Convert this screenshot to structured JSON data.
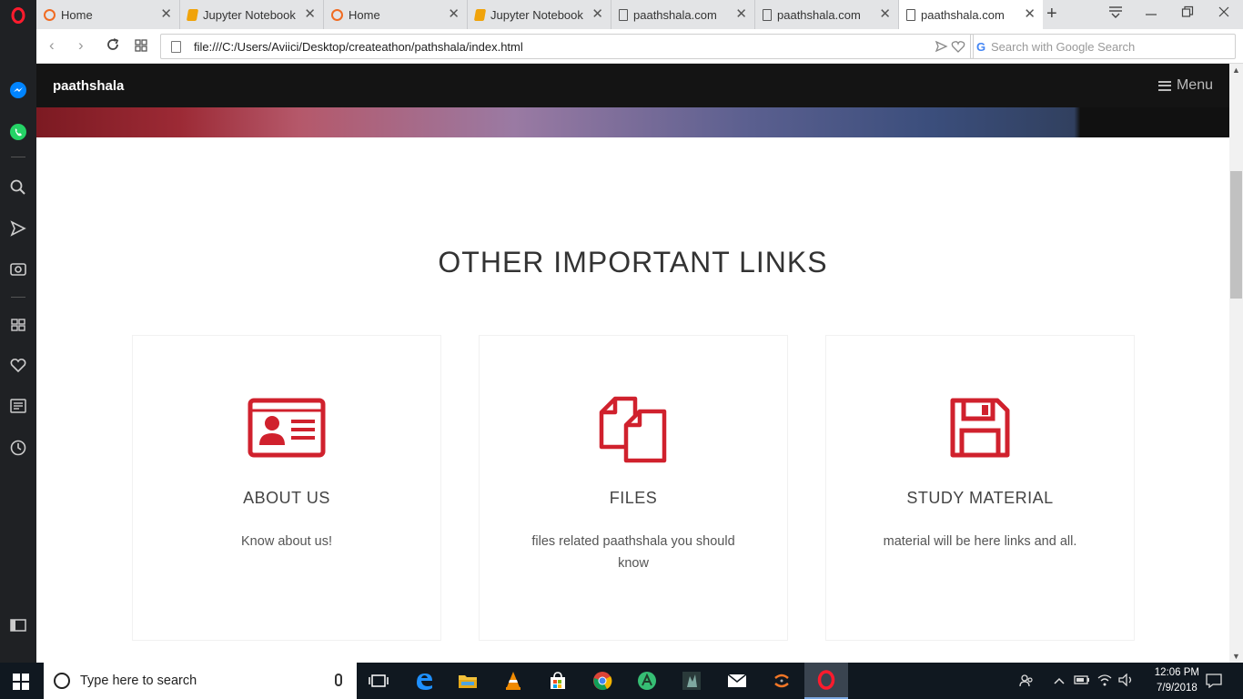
{
  "tabs": [
    {
      "title": "Home",
      "icon": "opera-icon"
    },
    {
      "title": "Jupyter Notebook",
      "icon": "notebook-icon"
    },
    {
      "title": "Home",
      "icon": "opera-icon"
    },
    {
      "title": "Jupyter Notebook",
      "icon": "notebook-icon"
    },
    {
      "title": "paathshala.com",
      "icon": "page-icon"
    },
    {
      "title": "paathshala.com",
      "icon": "page-icon"
    },
    {
      "title": "paathshala.com",
      "icon": "page-icon",
      "active": true
    }
  ],
  "address": {
    "url": "file:///C:/Users/Aviici/Desktop/createathon/pathshala/index.html",
    "search_placeholder": "Search with Google Search"
  },
  "site": {
    "brand": "paathshala",
    "menu_label": "Menu"
  },
  "section": {
    "title": "OTHER IMPORTANT LINKS",
    "cards": [
      {
        "icon": "id-card-icon",
        "title": "ABOUT US",
        "desc": "Know about us!"
      },
      {
        "icon": "files-icon",
        "title": "FILES",
        "desc": "files related paathshala you should know"
      },
      {
        "icon": "save-icon",
        "title": "STUDY MATERIAL",
        "desc": "material will be here links and all."
      }
    ]
  },
  "taskbar": {
    "search_placeholder": "Type here to search",
    "time": "12:06 PM",
    "date": "7/9/2018"
  },
  "colors": {
    "accent": "#d0212d",
    "nav_bg": "#141414",
    "taskbar_bg": "#101820"
  }
}
